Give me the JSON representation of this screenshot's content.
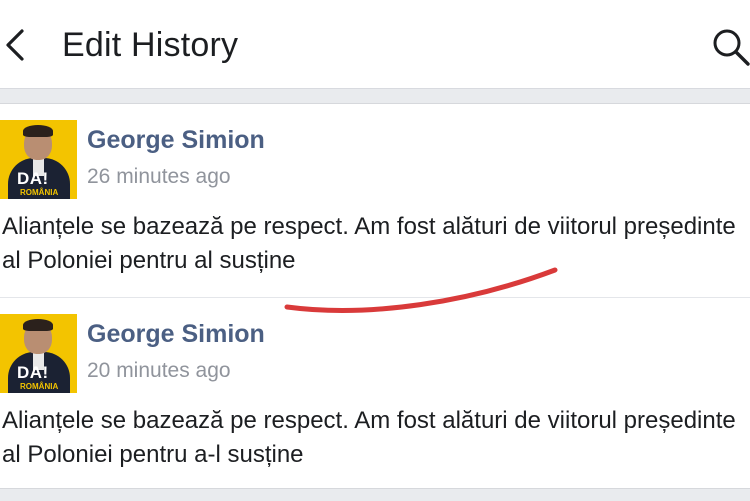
{
  "header": {
    "title": "Edit History",
    "back_icon": "chevron-left-icon",
    "search_icon": "search-icon"
  },
  "avatar": {
    "badge_text": "DA!",
    "badge_sub": "ROMÂNIA"
  },
  "revisions": [
    {
      "author": "George Simion",
      "time": "26 minutes ago",
      "text": "Alianțele se bazează pe respect. Am fost alături de viitorul președinte al Poloniei pentru al susține"
    },
    {
      "author": "George Simion",
      "time": "20 minutes ago",
      "text": "Alianțele se bazează pe respect. Am fost alături de viitorul președinte al Poloniei pentru a-l susține"
    }
  ],
  "colors": {
    "author": "#4b5f83",
    "timestamp": "#90949c",
    "divider": "#e9ebee",
    "annotation": "#d93a3a",
    "avatar_bg": "#f3c400"
  }
}
